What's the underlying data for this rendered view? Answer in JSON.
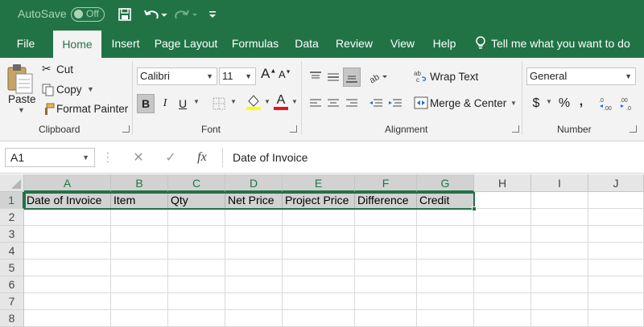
{
  "titlebar": {
    "autosave_label": "AutoSave",
    "autosave_state": "Off"
  },
  "tabs": [
    "File",
    "Home",
    "Insert",
    "Page Layout",
    "Formulas",
    "Data",
    "Review",
    "View",
    "Help"
  ],
  "active_tab": "Home",
  "tell_me": "Tell me what you want to do",
  "ribbon": {
    "clipboard": {
      "paste": "Paste",
      "cut": "Cut",
      "copy": "Copy",
      "format_painter": "Format Painter",
      "label": "Clipboard"
    },
    "font": {
      "name": "Calibri",
      "size": "11",
      "bold": "B",
      "italic": "I",
      "underline": "U",
      "font_color_letter": "A",
      "label": "Font"
    },
    "alignment": {
      "wrap_text": "Wrap Text",
      "merge_center": "Merge & Center",
      "label": "Alignment"
    },
    "number": {
      "format": "General",
      "currency": "$",
      "percent": "%",
      "comma": ",",
      "label": "Number"
    }
  },
  "formula_bar": {
    "name_box": "A1",
    "fx": "fx",
    "content": "Date of Invoice"
  },
  "grid": {
    "columns": [
      "A",
      "B",
      "C",
      "D",
      "E",
      "F",
      "G",
      "H",
      "I",
      "J"
    ],
    "rows": [
      "1",
      "2",
      "3",
      "4",
      "5",
      "6",
      "7",
      "8"
    ],
    "row1": [
      "Date of Invoice",
      "Item",
      "Qty",
      "Net Price",
      "Project Price",
      "Difference",
      "Credit"
    ]
  },
  "colors": {
    "accent": "#217346",
    "ribbon_bg": "#f3f3f3",
    "selection_fill": "#d2d2d2",
    "font_color_bar": "#e81123",
    "highlight_bar": "#ffff00"
  }
}
